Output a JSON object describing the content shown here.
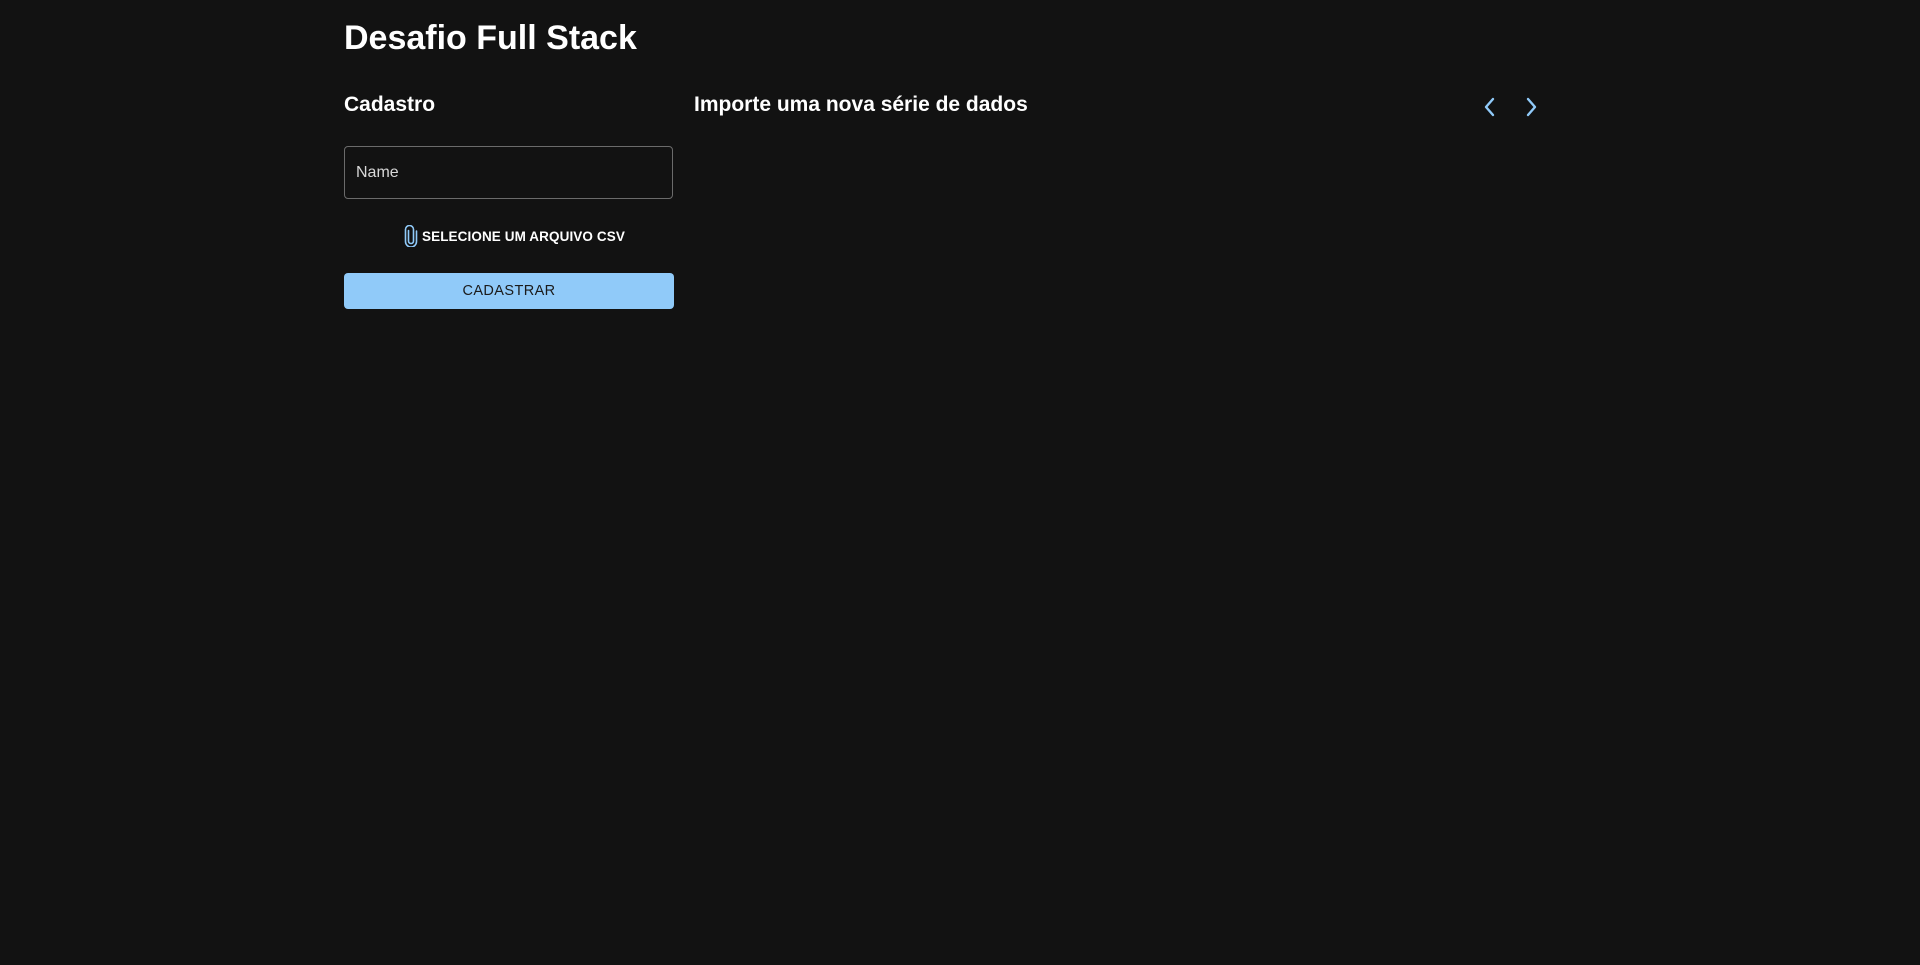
{
  "page": {
    "title": "Desafio Full Stack"
  },
  "cadastro": {
    "title": "Cadastro",
    "name_field": {
      "placeholder": "Name",
      "value": ""
    },
    "file_button": {
      "label": "SELECIONE UM ARQUIVO CSV",
      "icon": "paperclip-icon"
    },
    "submit_label": "CADASTRAR"
  },
  "import_panel": {
    "title": "Importe uma nova série de dados",
    "prev_icon": "chevron-left-icon",
    "next_icon": "chevron-right-icon"
  },
  "colors": {
    "background": "#121212",
    "text": "#ffffff",
    "accent": "#90caf9",
    "field_border": "#6b6b6b"
  }
}
